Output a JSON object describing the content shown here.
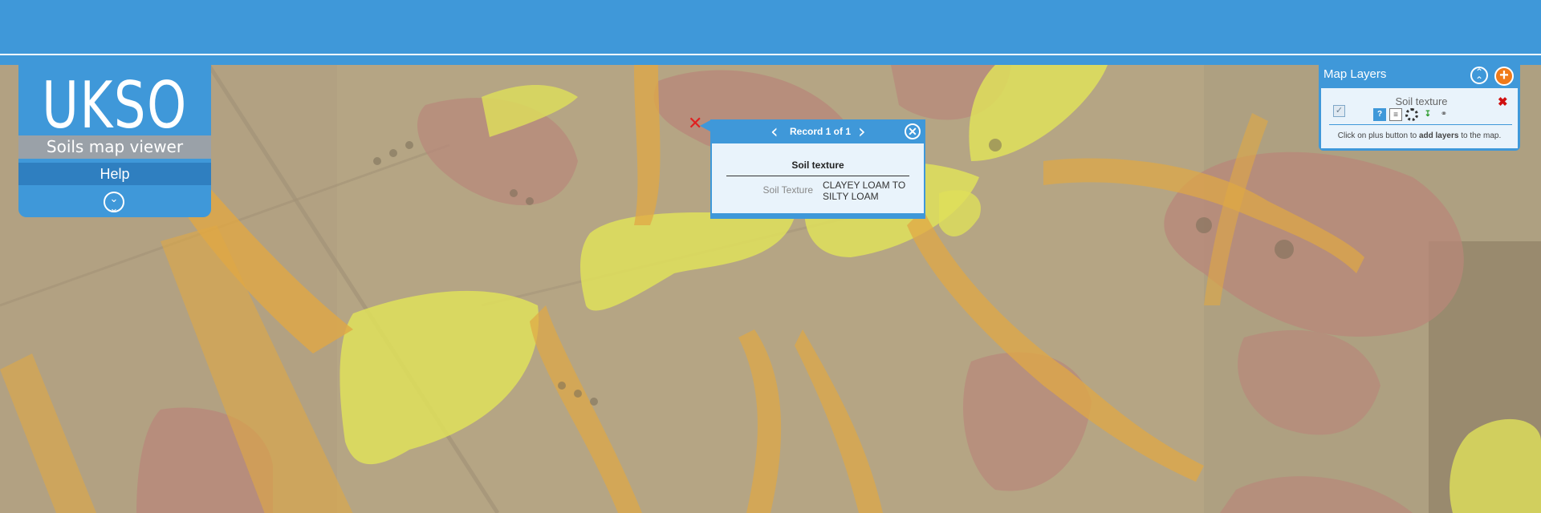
{
  "brand": {
    "logo": "UKSO",
    "subtitle": "Soils map viewer",
    "help_label": "Help",
    "expand_icon": "double-chevron-down-icon"
  },
  "popup": {
    "record_label": "Record 1 of 1",
    "title": "Soil texture",
    "field_label": "Soil Texture",
    "field_value": "CLAYEY LOAM TO SILTY LOAM",
    "prev_icon": "chevron-left-icon",
    "next_icon": "chevron-right-icon",
    "close_icon": "close-circle-icon"
  },
  "map_layers": {
    "title": "Map Layers",
    "layer_name": "Soil texture",
    "hint_prefix": "Click on plus button to",
    "hint_bold": "add layers",
    "hint_suffix": "to the map.",
    "layer_checked": true,
    "tools": [
      "info-icon",
      "legend-icon",
      "opacity-icon",
      "download-icon",
      "link-icon"
    ]
  },
  "colors": {
    "header": "#3f98d9",
    "map_background": "#b9a98a",
    "soil_yellow": "#dfe05a",
    "soil_orange": "#e0a845",
    "soil_red": "#b8877a",
    "marker": "#e02020",
    "add_button": "#f07a1a"
  }
}
